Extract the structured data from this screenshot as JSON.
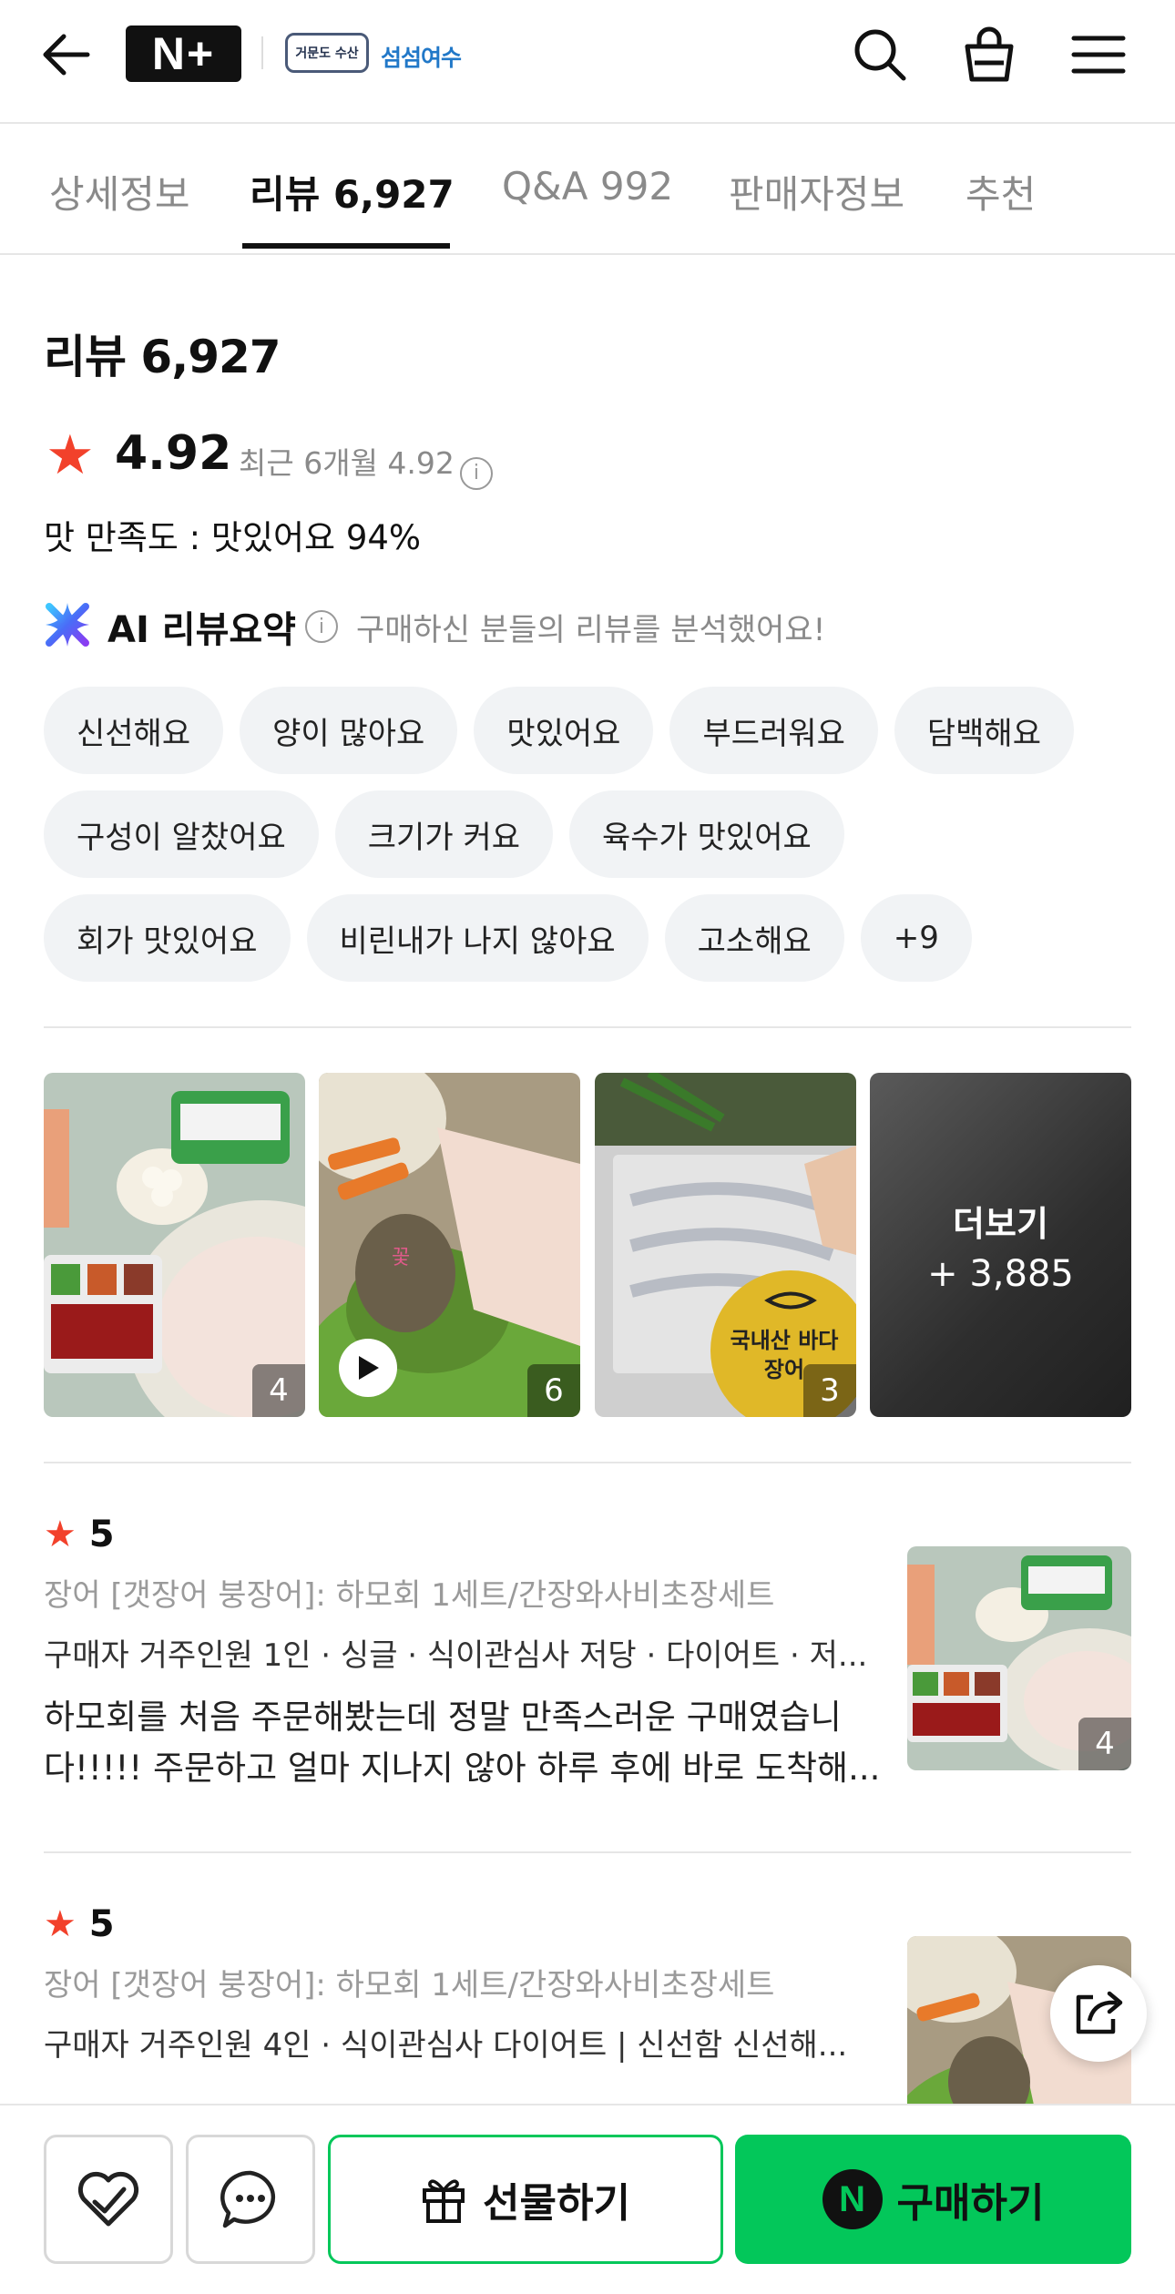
{
  "header": {
    "logo_text": "N+",
    "store_logo_text": "거문도 수산",
    "store_logo2_text": "섬섬여수",
    "icons": [
      "back-arrow-icon",
      "search-icon",
      "shopping-bag-icon",
      "menu-icon"
    ]
  },
  "tabs": [
    {
      "label": "상세정보",
      "active": false
    },
    {
      "label": "리뷰 6,927",
      "active": true
    },
    {
      "label": "Q&A 992",
      "active": false
    },
    {
      "label": "판매자정보",
      "active": false
    },
    {
      "label": "추천",
      "active": false
    }
  ],
  "summary": {
    "title": "리뷰 6,927",
    "rating": "4.92",
    "recent": "최근 6개월 4.92",
    "taste": "맛 만족도 : 맛있어요 94%",
    "ai_title": "AI 리뷰요약",
    "ai_desc": "구매하신 분들의 리뷰를 분석했어요!"
  },
  "chips": [
    [
      "신선해요",
      "양이 많아요",
      "맛있어요",
      "부드러워요",
      "담백해요"
    ],
    [
      "구성이 알찼어요",
      "크기가 커요",
      "육수가 맛있어요"
    ],
    [
      "회가 맛있어요",
      "비린내가 나지 않아요",
      "고소해요",
      "+9"
    ]
  ],
  "photos": [
    {
      "count": "4",
      "video": false
    },
    {
      "count": "6",
      "video": true
    },
    {
      "count": "3",
      "video": false,
      "overlay_text": "국내산 바다장어"
    }
  ],
  "more": {
    "label": "더보기",
    "count": "+ 3,885"
  },
  "reviews": [
    {
      "score": "5",
      "option": "장어 [갯장어 붕장어]: 하모회 1세트/간장와사비초장세트",
      "meta": "구매자 거주인원 1인 · 싱글 · 식이관심사 저당 · 다이어트 · 저...",
      "body": "하모회를 처음 주문해봤는데 정말 만족스러운 구매였습니다!!!!! 주문하고 얼마 지나지 않아 하루 후에 바로 도착해...",
      "thumb_count": "4"
    },
    {
      "score": "5",
      "option": "장어 [갯장어 붕장어]: 하모회 1세트/간장와사비초장세트",
      "meta": "구매자 거주인원 4인 · 식이관심사 다이어트 | 신선함 신선해...",
      "body": "",
      "thumb_count": ""
    }
  ],
  "bottom": {
    "gift_label": "선물하기",
    "buy_label": "구매하기",
    "buy_logo": "N"
  },
  "colors": {
    "accent_green": "#03c75a",
    "star_red": "#f2412b"
  }
}
